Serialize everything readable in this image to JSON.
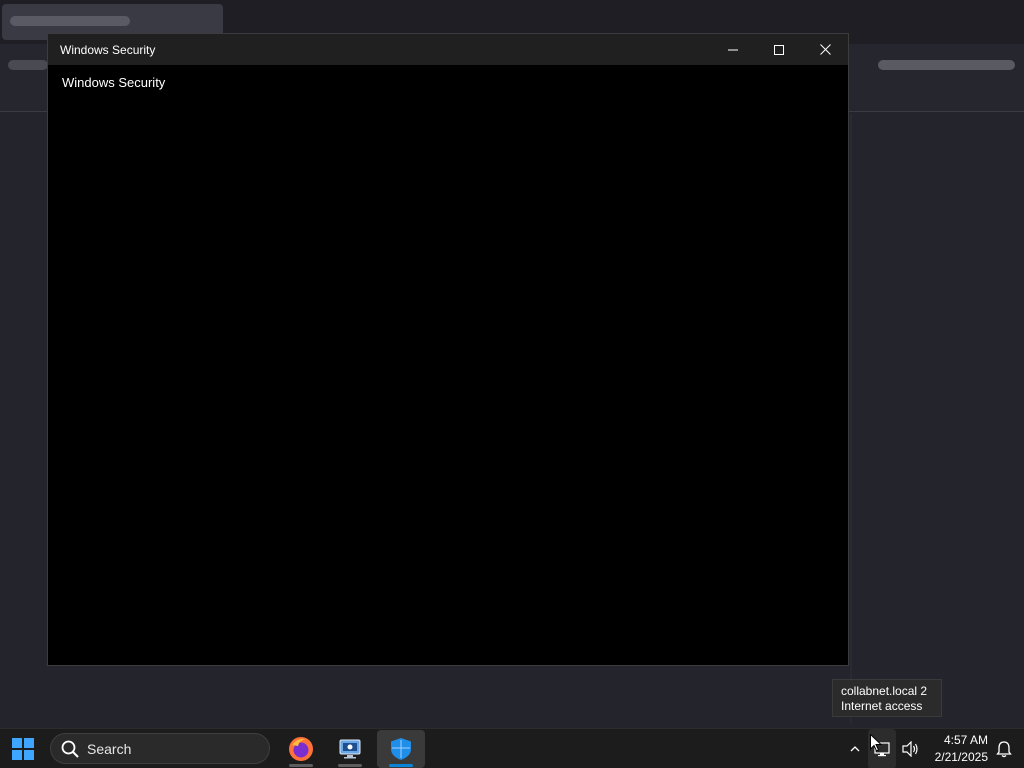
{
  "window": {
    "title": "Windows Security",
    "content_title": "Windows Security",
    "controls": {
      "minimize_icon": "minimize-icon",
      "maximize_icon": "maximize-icon",
      "close_icon": "close-icon"
    }
  },
  "tooltip": {
    "line1": "collabnet.local 2",
    "line2": "Internet access"
  },
  "taskbar": {
    "search_label": "Search",
    "apps": [
      {
        "name": "firefox",
        "icon": "firefox-icon"
      },
      {
        "name": "remote-desktop",
        "icon": "remote-desktop-icon"
      },
      {
        "name": "windows-security",
        "icon": "windows-security-shield-icon",
        "active": true
      }
    ],
    "clock": {
      "time": "4:57 AM",
      "date": "2/21/2025"
    }
  },
  "colors": {
    "accent": "#0b84d8",
    "window_bg": "#000000",
    "titlebar_bg": "#202020",
    "taskbar_bg": "#1c1c1c"
  }
}
